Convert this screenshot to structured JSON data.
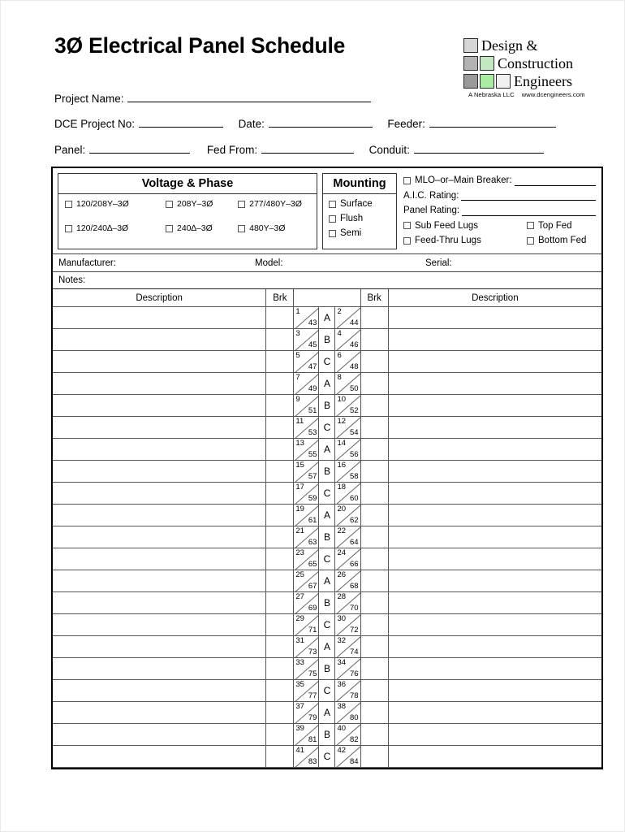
{
  "document": {
    "title": "3Ø Electrical Panel Schedule"
  },
  "logo": {
    "word1": "Design &",
    "word2": "Construction",
    "word3": "Engineers",
    "tagline_state": "A  Nebraska LLC",
    "tagline_url": "www.dcengineers.com",
    "colors": {
      "light_gray": "#d6d6d6",
      "mid_gray": "#b3b3b3",
      "dark_gray": "#9a9a9a",
      "green_dither": "#c3e9c0",
      "green_solid": "#a8eda2",
      "white_square": "#f0f0f0"
    }
  },
  "header_fields": {
    "project_name": {
      "label": "Project Name:",
      "value": ""
    },
    "dce_project_no": {
      "label": "DCE Project No:",
      "value": ""
    },
    "date": {
      "label": "Date:",
      "value": ""
    },
    "feeder": {
      "label": "Feeder:",
      "value": ""
    },
    "panel": {
      "label": "Panel:",
      "value": ""
    },
    "fed_from": {
      "label": "Fed From:",
      "value": ""
    },
    "conduit": {
      "label": "Conduit:",
      "value": ""
    }
  },
  "voltage_phase": {
    "title": "Voltage & Phase",
    "options": [
      {
        "label": "120/208Y–3Ø",
        "checked": false
      },
      {
        "label": "208Y–3Ø",
        "checked": false
      },
      {
        "label": "277/480Y–3Ø",
        "checked": false
      },
      {
        "label": "120/240∆–3Ø",
        "checked": false
      },
      {
        "label": "240∆–3Ø",
        "checked": false
      },
      {
        "label": "480Y–3Ø",
        "checked": false
      }
    ]
  },
  "mounting": {
    "title": "Mounting",
    "options": [
      {
        "label": "Surface",
        "checked": false
      },
      {
        "label": "Flush",
        "checked": false
      },
      {
        "label": "Semi",
        "checked": false
      }
    ]
  },
  "ratings": {
    "mlo_main_breaker": {
      "label": "MLO–or–Main Breaker:",
      "value": "",
      "checked": false
    },
    "aic_rating": {
      "label": "A.I.C. Rating:",
      "value": ""
    },
    "panel_rating": {
      "label": "Panel Rating:",
      "value": ""
    },
    "sub_feed_lugs": {
      "label": "Sub Feed Lugs",
      "checked": false
    },
    "top_fed": {
      "label": "Top Fed",
      "checked": false
    },
    "feed_thru_lugs": {
      "label": "Feed-Thru Lugs",
      "checked": false
    },
    "bottom_fed": {
      "label": "Bottom Fed",
      "checked": false
    }
  },
  "equipment": {
    "manufacturer": {
      "label": "Manufacturer:",
      "value": ""
    },
    "model": {
      "label": "Model:",
      "value": ""
    },
    "serial": {
      "label": "Serial:",
      "value": ""
    },
    "notes": {
      "label": "Notes:",
      "value": ""
    }
  },
  "circuit_table": {
    "headers": {
      "description_left": "Description",
      "brk_left": "Brk",
      "circuits": "",
      "brk_right": "Brk",
      "description_right": "Description"
    },
    "rows": [
      {
        "left_desc": "",
        "left_brk": "",
        "left_num_top": "1",
        "left_num_bot": "43",
        "phase": "A",
        "right_num_top": "2",
        "right_num_bot": "44",
        "right_brk": "",
        "right_desc": ""
      },
      {
        "left_desc": "",
        "left_brk": "",
        "left_num_top": "3",
        "left_num_bot": "45",
        "phase": "B",
        "right_num_top": "4",
        "right_num_bot": "46",
        "right_brk": "",
        "right_desc": ""
      },
      {
        "left_desc": "",
        "left_brk": "",
        "left_num_top": "5",
        "left_num_bot": "47",
        "phase": "C",
        "right_num_top": "6",
        "right_num_bot": "48",
        "right_brk": "",
        "right_desc": ""
      },
      {
        "left_desc": "",
        "left_brk": "",
        "left_num_top": "7",
        "left_num_bot": "49",
        "phase": "A",
        "right_num_top": "8",
        "right_num_bot": "50",
        "right_brk": "",
        "right_desc": ""
      },
      {
        "left_desc": "",
        "left_brk": "",
        "left_num_top": "9",
        "left_num_bot": "51",
        "phase": "B",
        "right_num_top": "10",
        "right_num_bot": "52",
        "right_brk": "",
        "right_desc": ""
      },
      {
        "left_desc": "",
        "left_brk": "",
        "left_num_top": "11",
        "left_num_bot": "53",
        "phase": "C",
        "right_num_top": "12",
        "right_num_bot": "54",
        "right_brk": "",
        "right_desc": ""
      },
      {
        "left_desc": "",
        "left_brk": "",
        "left_num_top": "13",
        "left_num_bot": "55",
        "phase": "A",
        "right_num_top": "14",
        "right_num_bot": "56",
        "right_brk": "",
        "right_desc": ""
      },
      {
        "left_desc": "",
        "left_brk": "",
        "left_num_top": "15",
        "left_num_bot": "57",
        "phase": "B",
        "right_num_top": "16",
        "right_num_bot": "58",
        "right_brk": "",
        "right_desc": ""
      },
      {
        "left_desc": "",
        "left_brk": "",
        "left_num_top": "17",
        "left_num_bot": "59",
        "phase": "C",
        "right_num_top": "18",
        "right_num_bot": "60",
        "right_brk": "",
        "right_desc": ""
      },
      {
        "left_desc": "",
        "left_brk": "",
        "left_num_top": "19",
        "left_num_bot": "61",
        "phase": "A",
        "right_num_top": "20",
        "right_num_bot": "62",
        "right_brk": "",
        "right_desc": ""
      },
      {
        "left_desc": "",
        "left_brk": "",
        "left_num_top": "21",
        "left_num_bot": "63",
        "phase": "B",
        "right_num_top": "22",
        "right_num_bot": "64",
        "right_brk": "",
        "right_desc": ""
      },
      {
        "left_desc": "",
        "left_brk": "",
        "left_num_top": "23",
        "left_num_bot": "65",
        "phase": "C",
        "right_num_top": "24",
        "right_num_bot": "66",
        "right_brk": "",
        "right_desc": ""
      },
      {
        "left_desc": "",
        "left_brk": "",
        "left_num_top": "25",
        "left_num_bot": "67",
        "phase": "A",
        "right_num_top": "26",
        "right_num_bot": "68",
        "right_brk": "",
        "right_desc": ""
      },
      {
        "left_desc": "",
        "left_brk": "",
        "left_num_top": "27",
        "left_num_bot": "69",
        "phase": "B",
        "right_num_top": "28",
        "right_num_bot": "70",
        "right_brk": "",
        "right_desc": ""
      },
      {
        "left_desc": "",
        "left_brk": "",
        "left_num_top": "29",
        "left_num_bot": "71",
        "phase": "C",
        "right_num_top": "30",
        "right_num_bot": "72",
        "right_brk": "",
        "right_desc": ""
      },
      {
        "left_desc": "",
        "left_brk": "",
        "left_num_top": "31",
        "left_num_bot": "73",
        "phase": "A",
        "right_num_top": "32",
        "right_num_bot": "74",
        "right_brk": "",
        "right_desc": ""
      },
      {
        "left_desc": "",
        "left_brk": "",
        "left_num_top": "33",
        "left_num_bot": "75",
        "phase": "B",
        "right_num_top": "34",
        "right_num_bot": "76",
        "right_brk": "",
        "right_desc": ""
      },
      {
        "left_desc": "",
        "left_brk": "",
        "left_num_top": "35",
        "left_num_bot": "77",
        "phase": "C",
        "right_num_top": "36",
        "right_num_bot": "78",
        "right_brk": "",
        "right_desc": ""
      },
      {
        "left_desc": "",
        "left_brk": "",
        "left_num_top": "37",
        "left_num_bot": "79",
        "phase": "A",
        "right_num_top": "38",
        "right_num_bot": "80",
        "right_brk": "",
        "right_desc": ""
      },
      {
        "left_desc": "",
        "left_brk": "",
        "left_num_top": "39",
        "left_num_bot": "81",
        "phase": "B",
        "right_num_top": "40",
        "right_num_bot": "82",
        "right_brk": "",
        "right_desc": ""
      },
      {
        "left_desc": "",
        "left_brk": "",
        "left_num_top": "41",
        "left_num_bot": "83",
        "phase": "C",
        "right_num_top": "42",
        "right_num_bot": "84",
        "right_brk": "",
        "right_desc": ""
      }
    ]
  }
}
